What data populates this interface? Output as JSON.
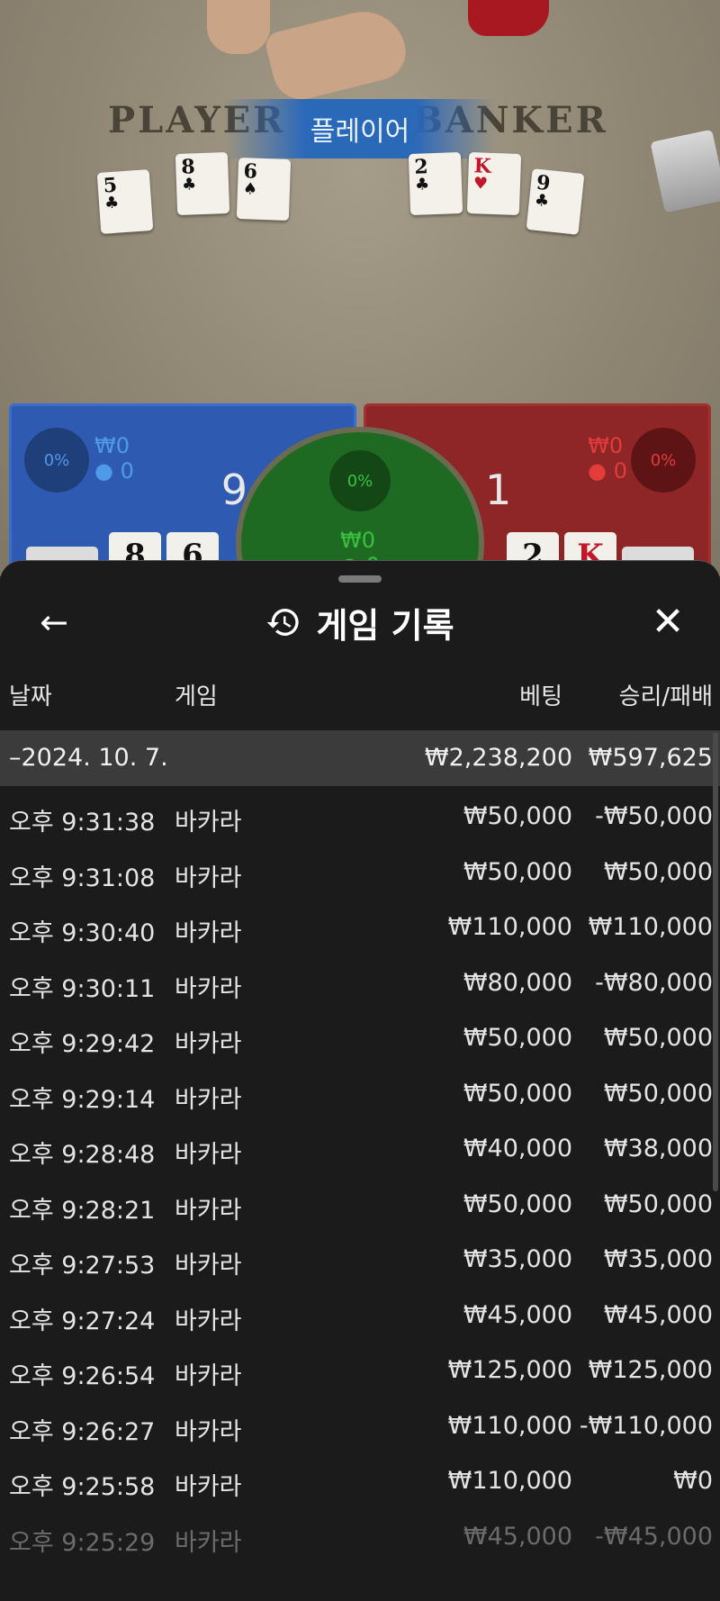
{
  "table": {
    "player_label": "PLAYER",
    "banker_label": "BANKER",
    "result_banner": "플레이어",
    "player_cards": [
      {
        "rank": "5",
        "suit": "♣",
        "red": false
      },
      {
        "rank": "8",
        "suit": "♣",
        "red": false
      },
      {
        "rank": "6",
        "suit": "♠",
        "red": false
      }
    ],
    "banker_cards": [
      {
        "rank": "2",
        "suit": "♣",
        "red": false
      },
      {
        "rank": "K",
        "suit": "♥",
        "red": true
      },
      {
        "rank": "9",
        "suit": "♣",
        "red": false
      }
    ]
  },
  "bets": {
    "player": {
      "percent": "0%",
      "amount": "₩0",
      "players": "0",
      "score": "9",
      "cards": [
        "8",
        "6"
      ]
    },
    "tie": {
      "percent": "0%",
      "amount": "₩0",
      "players": "0"
    },
    "banker": {
      "percent": "0%",
      "amount": "₩0",
      "players": "0",
      "score": "1",
      "cards": [
        "2",
        "K"
      ]
    },
    "colors": {
      "player": "#2e5bb1",
      "banker": "#8e2526",
      "tie": "#1f6a22"
    }
  },
  "history": {
    "title": "게임 기록",
    "back_icon": "arrow-left-icon",
    "close_icon": "close-icon",
    "columns": {
      "date": "날짜",
      "game": "게임",
      "bet": "베팅",
      "result": "승리/패배"
    },
    "summary": {
      "date": "–2024. 10. 7.",
      "bet": "₩2,238,200",
      "result": "₩597,625"
    },
    "rows": [
      {
        "time": "오후 9:31:38",
        "game": "바카라",
        "bet": "₩50,000",
        "result": "-₩50,000"
      },
      {
        "time": "오후 9:31:08",
        "game": "바카라",
        "bet": "₩50,000",
        "result": "₩50,000"
      },
      {
        "time": "오후 9:30:40",
        "game": "바카라",
        "bet": "₩110,000",
        "result": "₩110,000"
      },
      {
        "time": "오후 9:30:11",
        "game": "바카라",
        "bet": "₩80,000",
        "result": "-₩80,000"
      },
      {
        "time": "오후 9:29:42",
        "game": "바카라",
        "bet": "₩50,000",
        "result": "₩50,000"
      },
      {
        "time": "오후 9:29:14",
        "game": "바카라",
        "bet": "₩50,000",
        "result": "₩50,000"
      },
      {
        "time": "오후 9:28:48",
        "game": "바카라",
        "bet": "₩40,000",
        "result": "₩38,000"
      },
      {
        "time": "오후 9:28:21",
        "game": "바카라",
        "bet": "₩50,000",
        "result": "₩50,000"
      },
      {
        "time": "오후 9:27:53",
        "game": "바카라",
        "bet": "₩35,000",
        "result": "₩35,000"
      },
      {
        "time": "오후 9:27:24",
        "game": "바카라",
        "bet": "₩45,000",
        "result": "₩45,000"
      },
      {
        "time": "오후 9:26:54",
        "game": "바카라",
        "bet": "₩125,000",
        "result": "₩125,000"
      },
      {
        "time": "오후 9:26:27",
        "game": "바카라",
        "bet": "₩110,000",
        "result": "-₩110,000"
      },
      {
        "time": "오후 9:25:58",
        "game": "바카라",
        "bet": "₩110,000",
        "result": "₩0"
      },
      {
        "time": "오후 9:25:29",
        "game": "바카라",
        "bet": "₩45,000",
        "result": "-₩45,000"
      }
    ]
  }
}
